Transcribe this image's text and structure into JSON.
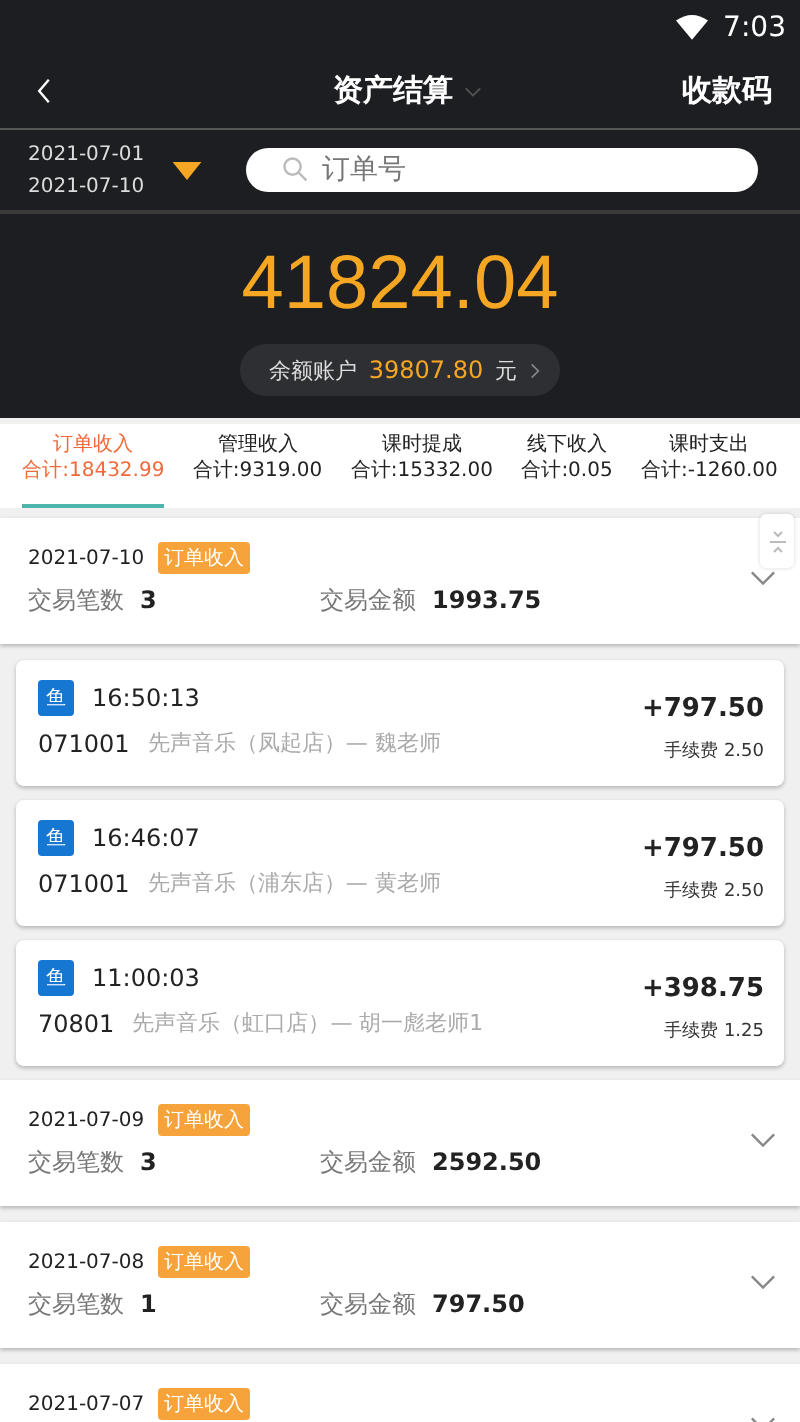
{
  "status_bar": {
    "time": "7:03"
  },
  "header": {
    "title": "资产结算",
    "action": "收款码"
  },
  "filter": {
    "date_from": "2021-07-01",
    "date_to": "2021-07-10",
    "search_placeholder": "订单号"
  },
  "summary": {
    "total": "41824.04",
    "balance_label": "余额账户",
    "balance": "39807.80",
    "unit": "元"
  },
  "tabs": [
    {
      "label": "订单收入",
      "sum": "合计:18432.99",
      "selected": true
    },
    {
      "label": "管理收入",
      "sum": "合计:9319.00",
      "selected": false
    },
    {
      "label": "课时提成",
      "sum": "合计:15332.00",
      "selected": false
    },
    {
      "label": "线下收入",
      "sum": "合计:0.05",
      "selected": false
    },
    {
      "label": "课时支出",
      "sum": "合计:-1260.00",
      "selected": false
    }
  ],
  "groups": [
    {
      "date": "2021-07-10",
      "tag": "订单收入",
      "count_label": "交易笔数",
      "count": "3",
      "amount_label": "交易金额",
      "amount": "1993.75",
      "items": [
        {
          "badge": "鱼",
          "time": "16:50:13",
          "code": "071001",
          "desc": "先声音乐（凤起店）— 魏老师",
          "amount": "+797.50",
          "fee_label": "手续费",
          "fee": "2.50"
        },
        {
          "badge": "鱼",
          "time": "16:46:07",
          "code": "071001",
          "desc": "先声音乐（浦东店）— 黄老师",
          "amount": "+797.50",
          "fee_label": "手续费",
          "fee": "2.50"
        },
        {
          "badge": "鱼",
          "time": "11:00:03",
          "code": "70801",
          "desc": "先声音乐（虹口店）— 胡一彪老师1",
          "amount": "+398.75",
          "fee_label": "手续费",
          "fee": "1.25"
        }
      ]
    },
    {
      "date": "2021-07-09",
      "tag": "订单收入",
      "count_label": "交易笔数",
      "count": "3",
      "amount_label": "交易金额",
      "amount": "2592.50"
    },
    {
      "date": "2021-07-08",
      "tag": "订单收入",
      "count_label": "交易笔数",
      "count": "1",
      "amount_label": "交易金额",
      "amount": "797.50"
    },
    {
      "date": "2021-07-07",
      "tag": "订单收入"
    }
  ]
}
